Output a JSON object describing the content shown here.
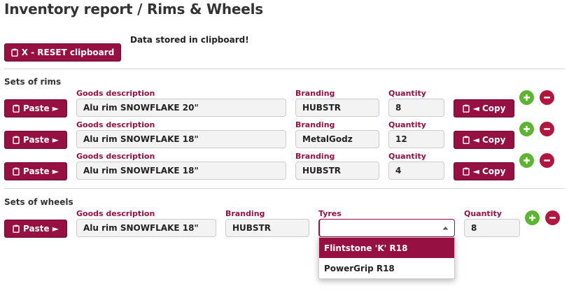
{
  "title": "Inventory report / Rims & Wheels",
  "reset_label": "X - RESET clipboard",
  "clipboard_status": "Data stored in clipboard!",
  "rims": {
    "section_label": "Sets of rims",
    "rows": [
      {
        "paste": "Paste ►",
        "desc_label": "Goods description",
        "desc": "Alu rim SNOWFLAKE 20\"",
        "brand_label": "Branding",
        "brand": "HUBSTR",
        "qty_label": "Quantity",
        "qty": "8",
        "copy": "◄ Copy"
      },
      {
        "paste": "Paste ►",
        "desc_label": "Goods description",
        "desc": "Alu rim SNOWFLAKE 18\"",
        "brand_label": "Branding",
        "brand": "MetalGodz",
        "qty_label": "Quantity",
        "qty": "12",
        "copy": "◄ Copy"
      },
      {
        "paste": "Paste ►",
        "desc_label": "Goods description",
        "desc": "Alu rim SNOWFLAKE 18\"",
        "brand_label": "Branding",
        "brand": "HUBSTR",
        "qty_label": "Quantity",
        "qty": "4",
        "copy": "◄ Copy"
      }
    ]
  },
  "wheels": {
    "section_label": "Sets of wheels",
    "row": {
      "paste": "Paste ►",
      "desc_label": "Goods description",
      "desc": "Alu rim SNOWFLAKE 18\"",
      "brand_label": "Branding",
      "brand": "HUBSTR",
      "tyres_label": "Tyres",
      "tyres_value": "",
      "qty_label": "Quantity",
      "qty": "8"
    },
    "tyre_options": [
      "Flintstone 'K' R18",
      "PowerGrip R18"
    ],
    "highlighted_option": "Flintstone 'K' R18"
  },
  "colors": {
    "accent": "#961042",
    "add": "#5cb531",
    "remove": "#b0163e"
  }
}
